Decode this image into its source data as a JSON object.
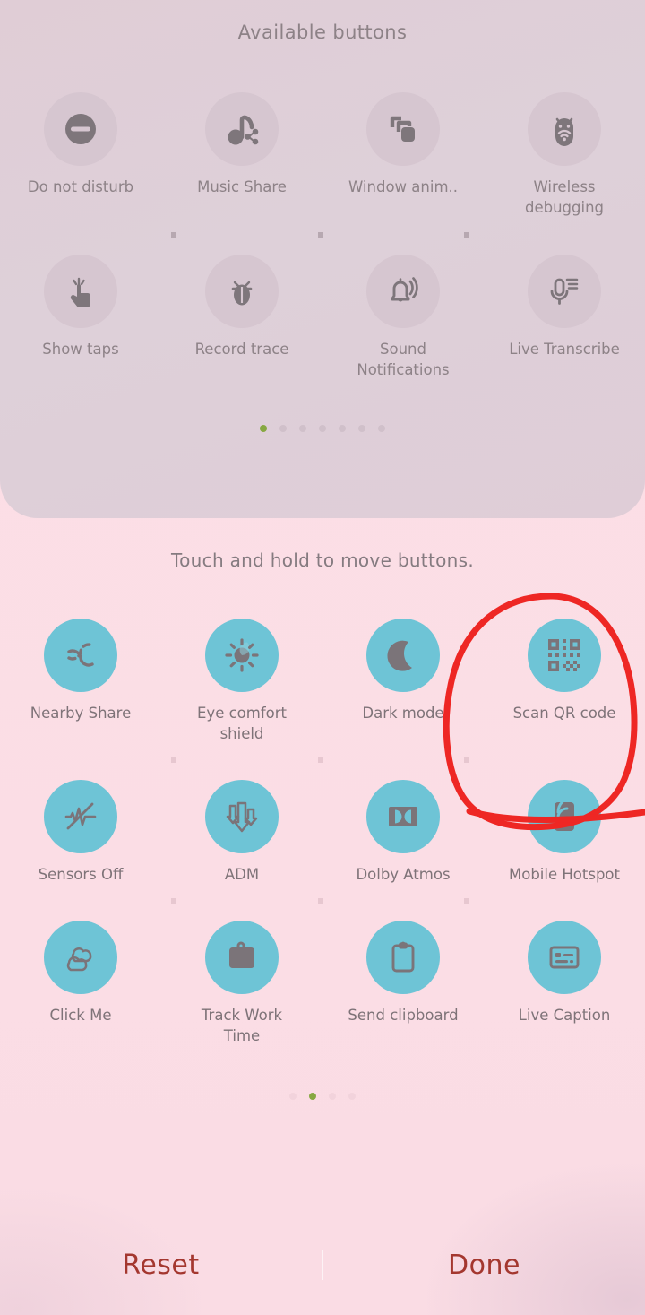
{
  "theme": {
    "panel_bg": "#dfcdd7",
    "page_bg": "#fcdfe6",
    "tile_muted": "#d6c6d0",
    "tile_active": "#6ec4d6",
    "icon_gray": "#7e767b",
    "label_gray": "#8d8287",
    "dot_active": "#87a842",
    "action_text": "#a4372f",
    "annotation_red": "#ee2724"
  },
  "available_panel": {
    "title": "Available buttons",
    "rows": [
      [
        {
          "label": "Do not disturb",
          "icon": "do-not-disturb-icon"
        },
        {
          "label": "Music Share",
          "icon": "music-share-icon"
        },
        {
          "label": "Window anim..",
          "icon": "window-animation-icon"
        },
        {
          "label": "Wireless debugging",
          "icon": "wireless-debugging-icon"
        }
      ],
      [
        {
          "label": "Show taps",
          "icon": "show-taps-icon"
        },
        {
          "label": "Record trace",
          "icon": "record-trace-bug-icon"
        },
        {
          "label": "Sound Notifications",
          "icon": "sound-notifications-bell-icon"
        },
        {
          "label": "Live Transcribe",
          "icon": "live-transcribe-mic-icon"
        }
      ]
    ],
    "pager": {
      "count": 7,
      "active_index": 0
    }
  },
  "current_panel": {
    "hint": "Touch and hold to move buttons.",
    "rows": [
      [
        {
          "label": "Nearby Share",
          "icon": "nearby-share-icon"
        },
        {
          "label": "Eye comfort shield",
          "icon": "eye-comfort-shield-sun-icon"
        },
        {
          "label": "Dark mode",
          "icon": "dark-mode-moon-icon"
        },
        {
          "label": "Scan QR code",
          "icon": "scan-qr-code-icon"
        }
      ],
      [
        {
          "label": "Sensors Off",
          "icon": "sensors-off-icon"
        },
        {
          "label": "ADM",
          "icon": "adm-arrows-icon"
        },
        {
          "label": "Dolby Atmos",
          "icon": "dolby-atmos-icon"
        },
        {
          "label": "Mobile Hotspot",
          "icon": "mobile-hotspot-icon"
        }
      ],
      [
        {
          "label": "Click Me",
          "icon": "click-me-cloud-icon"
        },
        {
          "label": "Track Work Time",
          "icon": "track-work-time-briefcase-icon"
        },
        {
          "label": "Send clipboard",
          "icon": "send-clipboard-icon"
        },
        {
          "label": "Live Caption",
          "icon": "live-caption-icon"
        }
      ]
    ],
    "pager": {
      "count": 4,
      "active_index": 1
    }
  },
  "actions": {
    "reset_label": "Reset",
    "done_label": "Done"
  },
  "annotation": {
    "shape": "hand-drawn-ellipse-with-tail",
    "target_label": "Scan QR code",
    "color": "#ee2724"
  }
}
